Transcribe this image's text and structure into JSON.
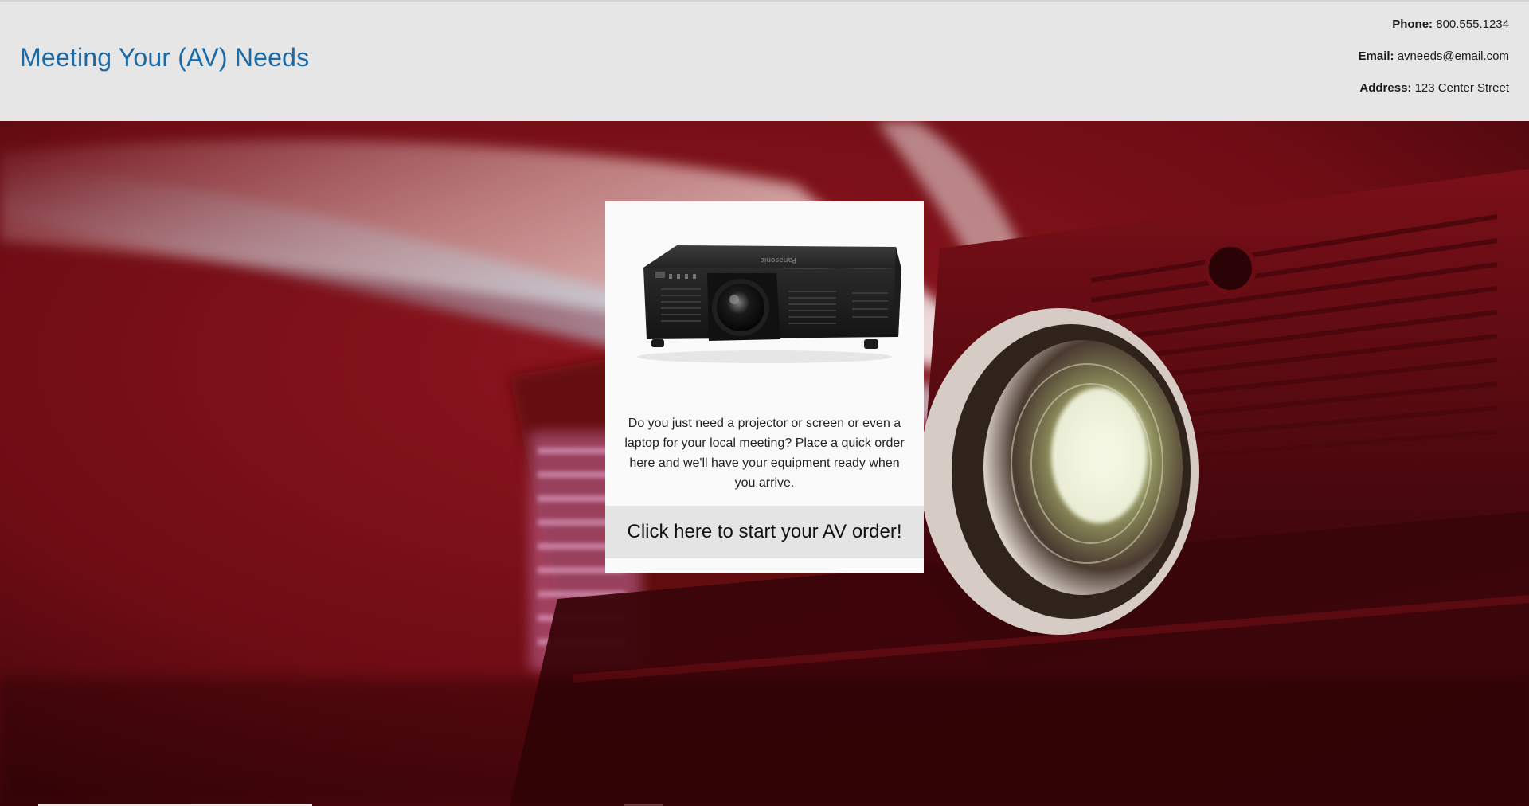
{
  "header": {
    "title": "Meeting Your (AV) Needs",
    "contact": {
      "phone_label": "Phone:",
      "phone": "800.555.1234",
      "email_label": "Email:",
      "email": "avneeds@email.com",
      "address_label": "Address:",
      "address": "123 Center Street"
    }
  },
  "hero": {
    "card": {
      "image": "projector-product-image",
      "description": "Do you just need a projector or screen or even a laptop for your local meeting? Place a quick order here and we'll have your equipment ready when you arrive.",
      "cta_label": "Click here to start your AV order!"
    }
  },
  "colors": {
    "title": "#1b6aa5",
    "header_bg": "#e6e6e6",
    "hero_bg": "#7a0f18",
    "card_bg": "#fafafa",
    "button_bg": "#e4e4e4"
  }
}
